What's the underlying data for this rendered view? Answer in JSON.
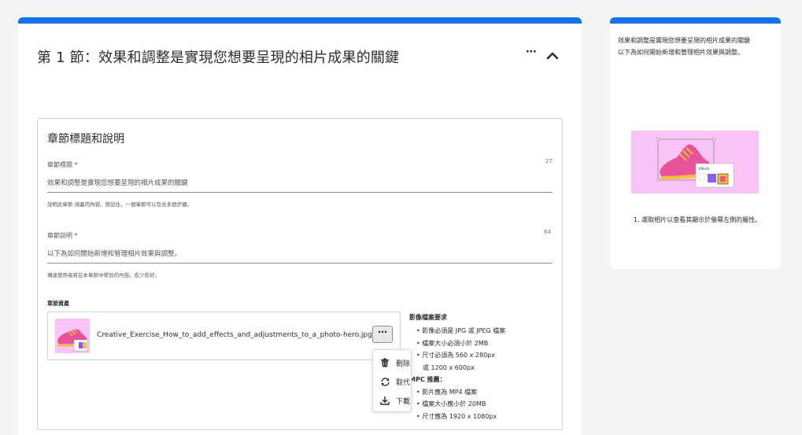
{
  "section": {
    "title": "第 1 節：效果和調整是實現您想要呈現的相片成果的關鍵",
    "more_label": "⋯",
    "collapse_icon": "chevron-up-icon"
  },
  "inner": {
    "title": "章節標題和說明",
    "title_field": {
      "label": "章節標題 *",
      "count": "27",
      "value": "效果和調整是實現您想要呈現的相片成果的關鍵",
      "help": "說明此章節 涵蓋的內容。簡記住，一個章節可以包含多個步驟。"
    },
    "desc_field": {
      "label": "章節說明 *",
      "count": "64",
      "value": "以下為如何開始新增和管理相片效果與調整。",
      "help": "傳達使用者將在本章節中學到的內容。愈少愈好。"
    },
    "assets": {
      "label": "章節資產",
      "filename": "Creative_Exercise_How_to_add_effects_and_adjustments_to_a_photo-hero.jpg",
      "more_label": "⋯"
    },
    "requirements": {
      "title": "影像檔案要求",
      "lines": [
        "• 影像必須是 JPG 或 JPEG 檔案",
        "• 檔案大小必須小於 2MB",
        "• 尺寸必須為 560 x 280px",
        "或 1200 x 600px"
      ],
      "mpc_title": "MPC 推薦：",
      "mpc_lines": [
        "• 影片應為 MP4 檔案",
        "• 檔案大小應小於 20MB",
        "• 尺寸應為 1920 x 1080px"
      ]
    }
  },
  "context_menu": {
    "delete": "刪除",
    "replace": "取代",
    "download": "下載"
  },
  "preview": {
    "text_line1": "效果和調整是實現您想要呈現的相片成果的關鍵",
    "text_line2": "以下為如何開始新增和管理相片效果與調整。",
    "step": "1. 選取相片以查看其顯示於螢幕左側的屬性。",
    "image_label": "Effects"
  },
  "colors": {
    "accent": "#1473e6",
    "thumb_bg": "#f9c3f5",
    "shoe_pink": "#e8529a",
    "shoe_yellow": "#f5c030"
  }
}
